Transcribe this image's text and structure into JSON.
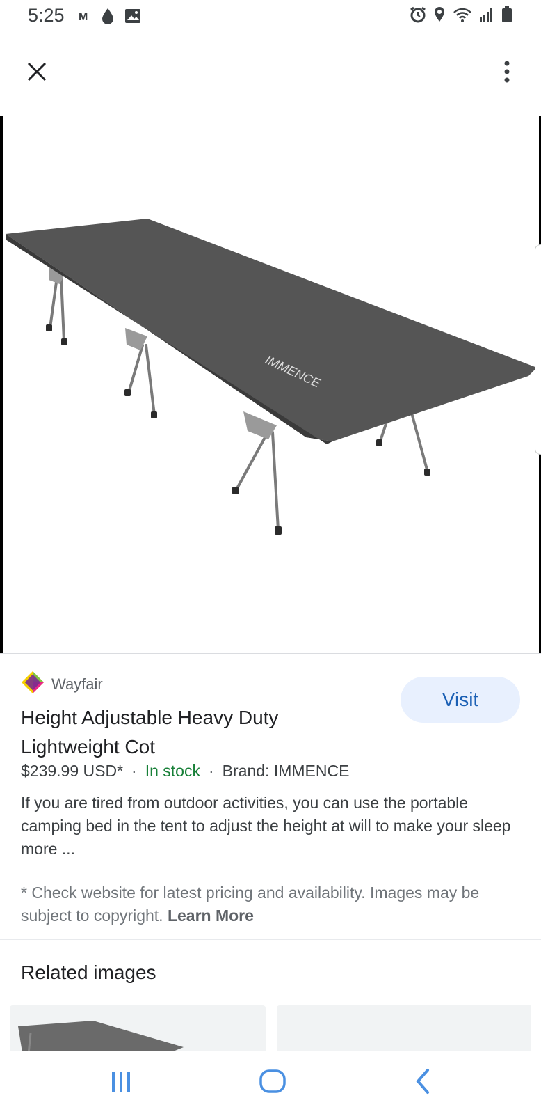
{
  "status_bar": {
    "time": "5:25",
    "left_icons": [
      "gmail-icon",
      "drop-icon",
      "image-icon"
    ],
    "right_icons": [
      "alarm-icon",
      "location-icon",
      "wifi-icon",
      "signal-icon",
      "battery-icon"
    ]
  },
  "top_bar": {
    "close_icon": "close-icon",
    "more_icon": "more-vert-icon"
  },
  "result": {
    "source": {
      "name": "Wayfair",
      "logo_icon": "wayfair-logo"
    },
    "visit_label": "Visit",
    "title": "Height Adjustable Heavy Duty Lightweight Cot",
    "price": "$239.99 USD*",
    "separator": "·",
    "stock": "In stock",
    "brand": "Brand: IMMENCE",
    "description": "If you are tired from outdoor activities, you can use the portable camping bed in the tent to adjust the height at will to make your sleep more ...",
    "disclaimer": "* Check website for latest pricing and availability. Images may be subject to copyright.",
    "learn_more": "Learn More",
    "cot_logo_text": "IMMENCE"
  },
  "related": {
    "heading": "Related images"
  },
  "nav_bar": {
    "items": [
      "recent-apps-icon",
      "home-icon",
      "back-icon"
    ]
  },
  "colors": {
    "accent": "#1a5fb4",
    "visit_bg": "#e8f0fe",
    "stock_green": "#188038",
    "nav_blue": "#4a90e2",
    "cot_fabric": "#555555"
  }
}
